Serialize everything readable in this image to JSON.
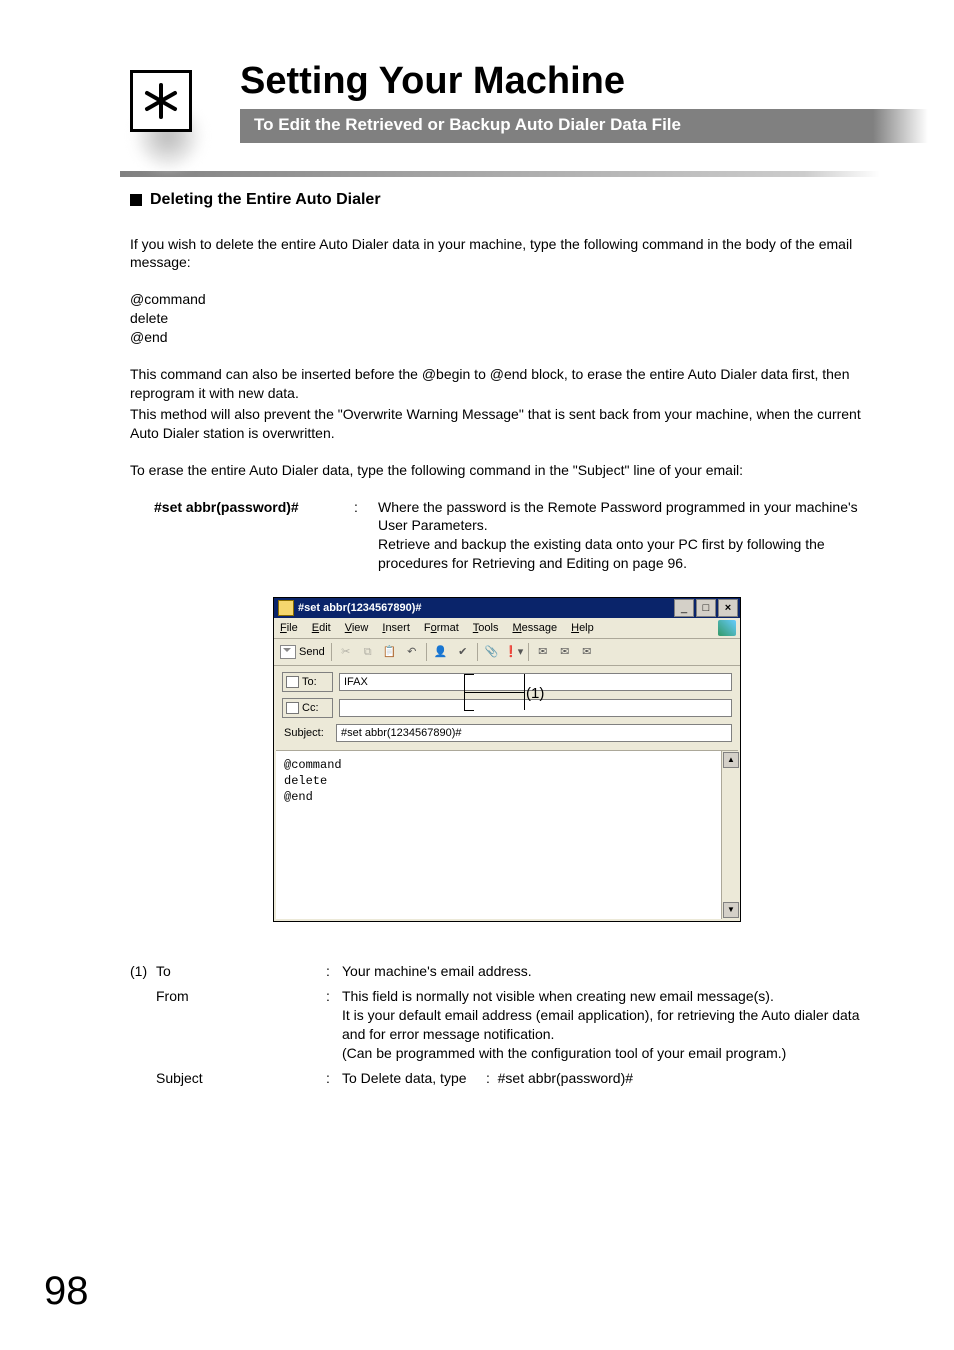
{
  "header": {
    "chapter_title": "Setting Your Machine",
    "sub_bar": "To Edit the Retrieved or Backup Auto Dialer Data File"
  },
  "section": {
    "heading": "Deleting the Entire Auto Dialer",
    "intro": "If you wish to delete the entire Auto Dialer data in your machine, type the following command in the body of the email message:",
    "cmd_lines": [
      "@command",
      "delete",
      "@end"
    ],
    "after1": "This command can also be inserted before the @begin to @end block, to erase the entire Auto Dialer data first, then reprogram it with new data.",
    "after2": "This method will also prevent the \"Overwrite Warning Message\" that is sent back from your machine, when the current Auto Dialer station is overwritten.",
    "after3": "To erase the entire Auto Dialer data, type the following command in the \"Subject\" line of your email:",
    "def_label": "#set abbr(password)#",
    "def_desc1": "Where the password is the Remote Password programmed in your machine's User Parameters.",
    "def_desc2": "Retrieve and backup the existing data onto your PC first by following the procedures for Retrieving and Editing on page 96."
  },
  "email": {
    "title": "#set abbr(1234567890)#",
    "menus": [
      "File",
      "Edit",
      "View",
      "Insert",
      "Format",
      "Tools",
      "Message",
      "Help"
    ],
    "send_label": "Send",
    "fields": {
      "to_label": "To:",
      "to_value": "IFAX",
      "cc_label": "Cc:",
      "cc_value": "",
      "subject_label": "Subject:",
      "subject_value": "#set abbr(1234567890)#"
    },
    "body": "@command\ndelete\n@end",
    "callout_number": "(1)"
  },
  "legend": {
    "num": "(1)",
    "rows": [
      {
        "label": "To",
        "desc": "Your machine's email address."
      },
      {
        "label": "From",
        "desc": "This field is normally not visible when creating new email message(s).\nIt is your default email address (email application), for retrieving the Auto dialer data and for error message notification.\n(Can be programmed with the configuration tool of your email program.)"
      },
      {
        "label": "Subject",
        "desc": "To Delete data, type     :  #set abbr(password)#"
      }
    ]
  },
  "page_number": "98"
}
